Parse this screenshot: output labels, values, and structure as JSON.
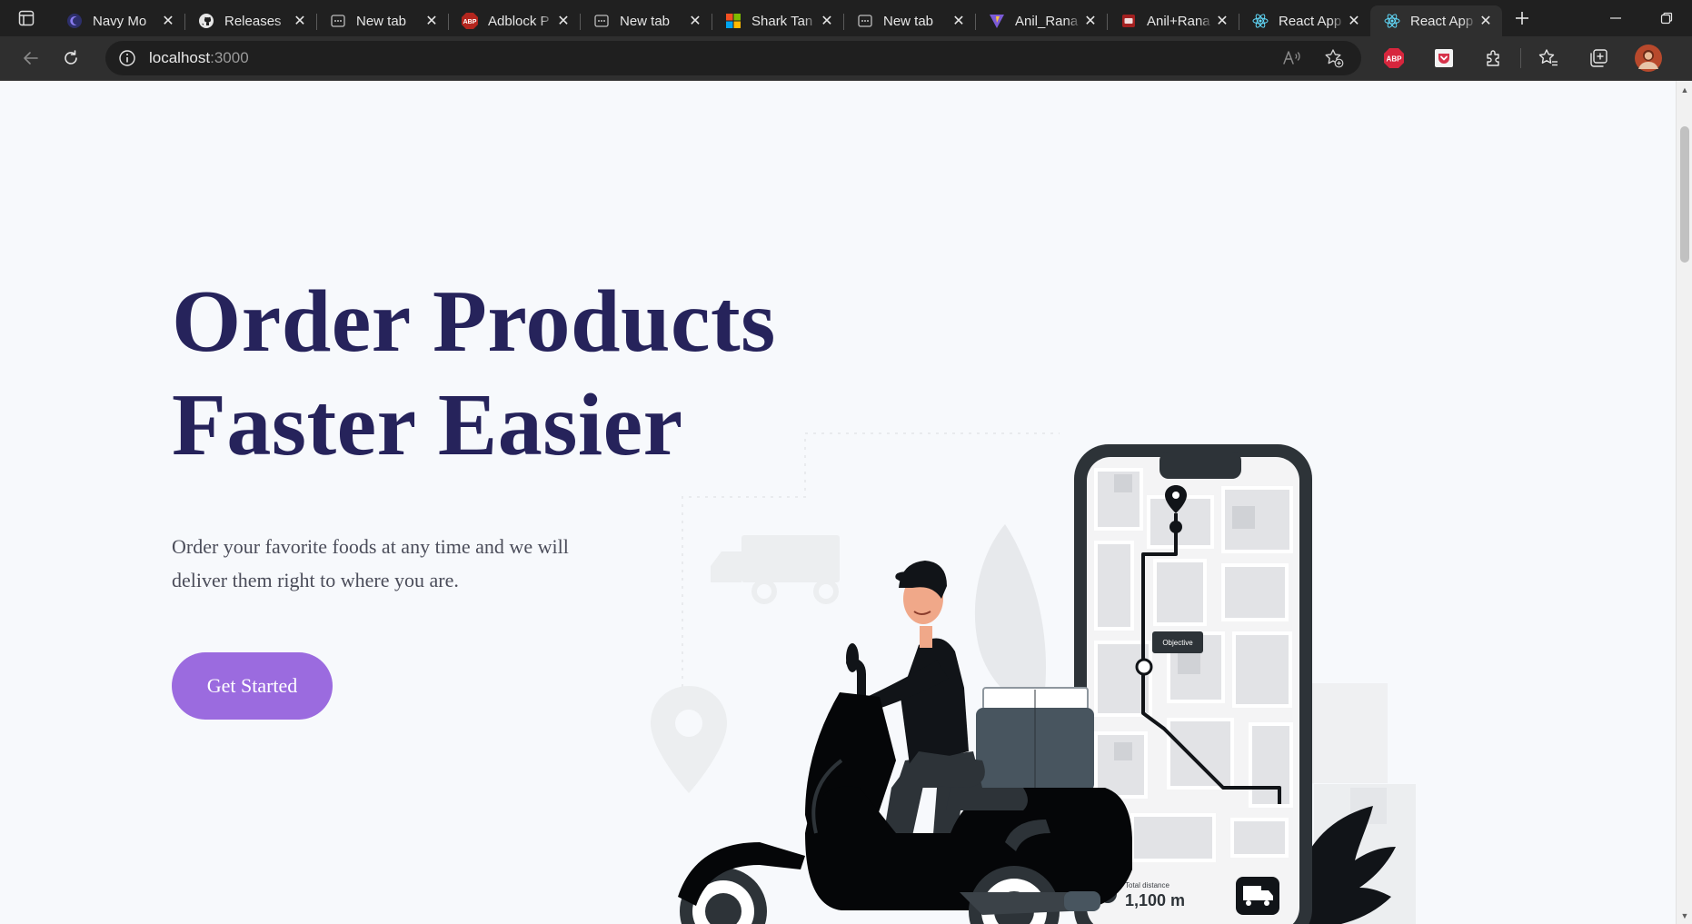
{
  "browser": {
    "tabs": [
      {
        "title": "Navy Mo",
        "icon": "navy-moon-icon",
        "active": false
      },
      {
        "title": "Releases",
        "icon": "github-icon",
        "active": false
      },
      {
        "title": "New tab",
        "icon": "new-tab-page-icon",
        "active": false
      },
      {
        "title": "Adblock P",
        "icon": "abp-icon",
        "active": false
      },
      {
        "title": "New tab",
        "icon": "new-tab-page-icon",
        "active": false
      },
      {
        "title": "Shark Tan",
        "icon": "microsoft-icon",
        "active": false
      },
      {
        "title": "New tab",
        "icon": "new-tab-page-icon",
        "active": false
      },
      {
        "title": "Anil_Rana",
        "icon": "vite-icon",
        "active": false
      },
      {
        "title": "Anil+Rana",
        "icon": "pdf-icon",
        "active": false
      },
      {
        "title": "React App",
        "icon": "react-icon",
        "active": false
      },
      {
        "title": "React App",
        "icon": "react-icon",
        "active": true
      }
    ],
    "address": {
      "host": "localhost",
      "port": ":3000"
    },
    "extensions": {
      "abp_label": "ABP"
    }
  },
  "hero": {
    "title_line1": "Order Products",
    "title_line2": "Faster Easier",
    "subtitle": "Order your favorite foods at any time and we will deliver them right to where you are.",
    "cta_label": "Get Started"
  },
  "illustration": {
    "map_tag": "Objective",
    "distance_label": "Total distance",
    "distance_value": "1,100 m"
  },
  "colors": {
    "title": "#26235b",
    "accent": "#9b6bdf",
    "page_bg": "#f7f9fc",
    "phone_frame": "#2d3338",
    "box": "#48555f"
  }
}
